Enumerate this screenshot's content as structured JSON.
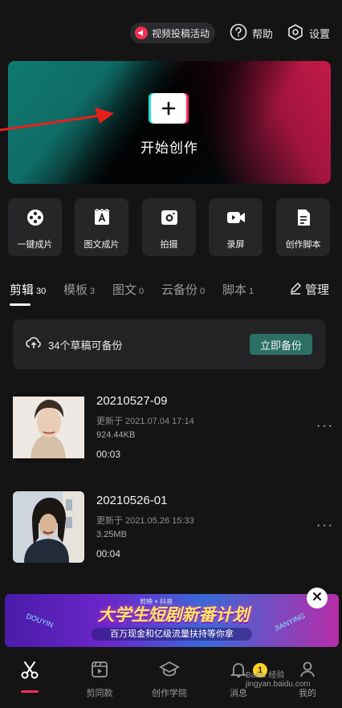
{
  "topbar": {
    "promo_label": "视频投稿活动",
    "help_label": "帮助",
    "settings_label": "设置"
  },
  "hero": {
    "start_label": "开始创作"
  },
  "tools": [
    {
      "label": "一键成片",
      "icon": "film-reel-icon"
    },
    {
      "label": "图文成片",
      "icon": "text-image-icon"
    },
    {
      "label": "拍摄",
      "icon": "camera-icon"
    },
    {
      "label": "录屏",
      "icon": "screen-record-icon"
    },
    {
      "label": "创作脚本",
      "icon": "script-doc-icon"
    }
  ],
  "tabs": [
    {
      "label": "剪辑",
      "count": "30"
    },
    {
      "label": "模板",
      "count": "3"
    },
    {
      "label": "图文",
      "count": "0"
    },
    {
      "label": "云备份",
      "count": "0"
    },
    {
      "label": "脚本",
      "count": "1"
    }
  ],
  "manage_label": "管理",
  "backup": {
    "text": "34个草稿可备份",
    "button": "立即备份"
  },
  "drafts": [
    {
      "name": "20210527-09",
      "updated": "更新于 2021.07.04 17:14",
      "size": "924.44KB",
      "duration": "00:03"
    },
    {
      "name": "20210526-01",
      "updated": "更新于 2021.05.26 15:33",
      "size": "3.25MB",
      "duration": "00:04"
    }
  ],
  "banner": {
    "logos": "剪映 × 抖音",
    "title": "大学生短剧新番计划",
    "subtitle": "百万现金和亿级流量扶持等你拿",
    "side_left": "DOUYIN",
    "side_right": "JIANYING"
  },
  "bottom_nav": [
    {
      "label": "",
      "icon": "scissors-icon"
    },
    {
      "label": "剪同款",
      "icon": "template-icon"
    },
    {
      "label": "创作学院",
      "icon": "graduation-cap-icon"
    },
    {
      "label": "消息",
      "icon": "bell-icon"
    },
    {
      "label": "我的",
      "icon": "person-icon"
    }
  ],
  "message_badge": "1",
  "watermark": "Baidu 经验 jingyan.baidu.com",
  "colors": {
    "background": "#141414",
    "accent_red": "#ff2a5f",
    "accent_teal": "#1fe0d8",
    "backup_button": "#2c6f66"
  }
}
